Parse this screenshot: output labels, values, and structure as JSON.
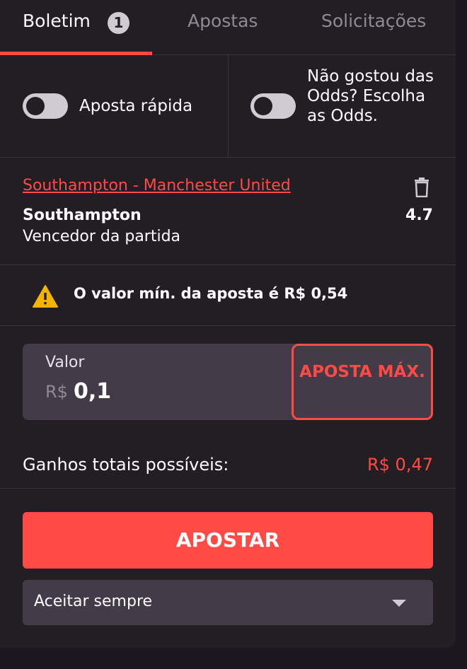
{
  "tabs": {
    "boletim": "Boletim",
    "badge_count": "1",
    "apostas": "Apostas",
    "solicitacoes": "Solicitações"
  },
  "toggles": {
    "quick_bet": {
      "label": "Aposta rápida",
      "on": false
    },
    "choose_odds": {
      "label": "Não gostou das Odds? Escolha as Odds.",
      "on": false
    }
  },
  "selection": {
    "event": "Southampton - Manchester United",
    "team": "Southampton",
    "odds": "4.7",
    "market": "Vencedor da partida"
  },
  "warning": {
    "icon": "warning-icon",
    "text": "O valor mín. da aposta é R$ 0,54"
  },
  "stake": {
    "label": "Valor",
    "currency": "R$",
    "value": "0,1",
    "max_button": "APOSTA MÁX."
  },
  "winnings": {
    "label": "Ganhos totais possíveis:",
    "value": "R$ 0,47"
  },
  "place_bet": "APOSTAR",
  "accept_select": {
    "selected": "Aceitar sempre"
  },
  "colors": {
    "accent": "#ff4a45",
    "panel": "#221e24",
    "background": "#1c171f",
    "field": "#443b48"
  }
}
